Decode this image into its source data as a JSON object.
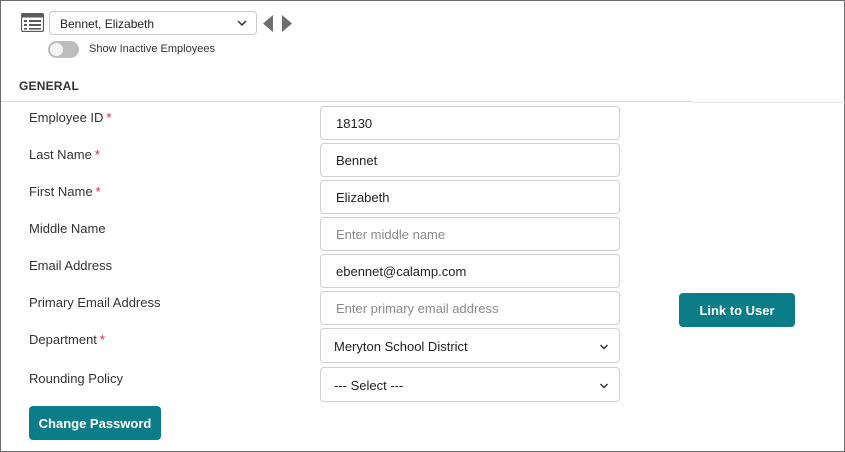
{
  "toolbar": {
    "employee_selected": "Bennet, Elizabeth",
    "show_inactive_label": "Show Inactive Employees",
    "show_inactive_on": false
  },
  "section": {
    "title": "GENERAL"
  },
  "fields": {
    "employee_id": {
      "label": "Employee ID",
      "value": "18130",
      "required": "*"
    },
    "last_name": {
      "label": "Last Name",
      "value": "Bennet",
      "required": "*"
    },
    "first_name": {
      "label": "First Name",
      "value": "Elizabeth",
      "required": "*"
    },
    "middle_name": {
      "label": "Middle Name",
      "value": "",
      "placeholder": "Enter middle name"
    },
    "email": {
      "label": "Email Address",
      "value": "ebennet@calamp.com"
    },
    "primary_email": {
      "label": "Primary Email Address",
      "value": "",
      "placeholder": "Enter primary email address"
    },
    "department": {
      "label": "Department",
      "value": "Meryton School District",
      "required": "*"
    },
    "rounding_policy": {
      "label": "Rounding Policy",
      "value": "--- Select ---"
    }
  },
  "buttons": {
    "link_to_user": "Link to User",
    "change_password": "Change Password"
  },
  "colors": {
    "accent": "#0b7d88",
    "required": "#d9232e",
    "nav_arrow": "#6e6e6e"
  },
  "icons": {
    "list": "list-view-icon",
    "prev": "caret-left-icon",
    "next": "caret-right-icon",
    "dropdown": "chevron-down-icon"
  }
}
